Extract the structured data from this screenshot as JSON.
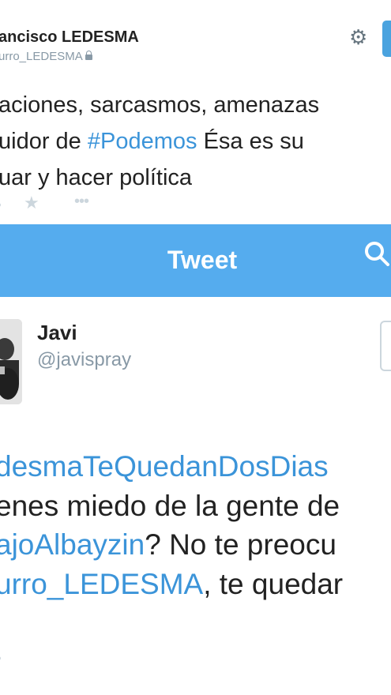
{
  "tweet1": {
    "author_name": "ancisco LEDESMA",
    "author_handle": "urro_LEDESMA",
    "lines": [
      {
        "text": "aciones, sarcasmos, amenazas"
      },
      {
        "prefix": "uidor de ",
        "hashtag": "#Podemos",
        "suffix": " Ésa es su"
      },
      {
        "text": "uar y hacer política"
      }
    ]
  },
  "header": {
    "title": "Tweet"
  },
  "tweet2": {
    "name": "Javi",
    "handle": "@javispray",
    "line1": "desmaTeQuedanDosDias",
    "line2": "enes miedo de la gente de",
    "line3_link": "ajoAlbayzin",
    "line3_rest": "? No te preocu",
    "line4_link": "urro_LEDESMA",
    "line4_rest": ", te quedar"
  },
  "icons": {
    "settings": "gear-icon",
    "lock": "lock-icon",
    "favorite": "star-icon",
    "more": "more-icon",
    "search": "search-icon"
  },
  "colors": {
    "header": "#55acee",
    "link": "#3b94d9",
    "muted": "#8899a6"
  }
}
